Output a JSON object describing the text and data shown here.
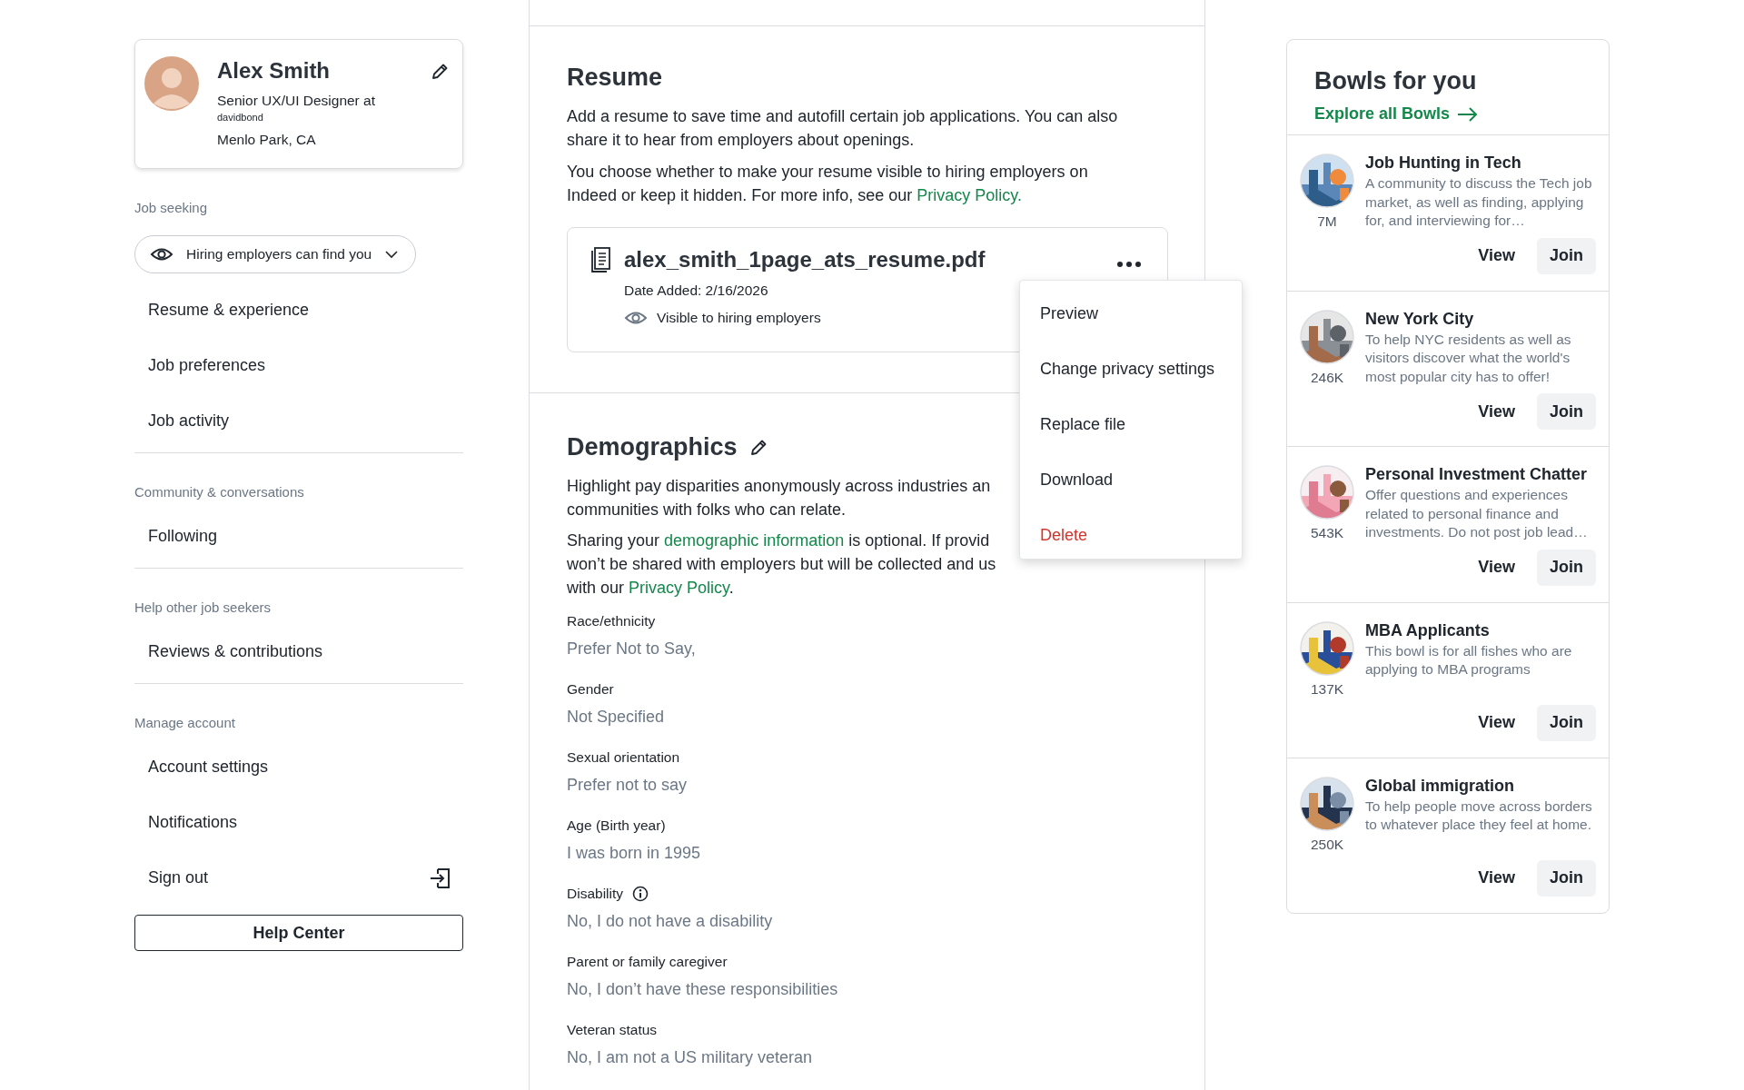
{
  "sidebar": {
    "profile": {
      "name": "Alex Smith",
      "title": "Senior UX/UI Designer at",
      "company": "davidbond",
      "location": "Menlo Park, CA"
    },
    "sections": [
      {
        "heading": "Job seeking",
        "items": [
          {
            "kind": "dropdown",
            "label": "Hiring employers can find you"
          },
          {
            "kind": "link",
            "label": "Resume & experience"
          },
          {
            "kind": "link",
            "label": "Job preferences"
          },
          {
            "kind": "link",
            "label": "Job activity"
          }
        ]
      },
      {
        "heading": "Community & conversations",
        "items": [
          {
            "kind": "link",
            "label": "Following"
          }
        ]
      },
      {
        "heading": "Help other job seekers",
        "items": [
          {
            "kind": "link",
            "label": "Reviews & contributions"
          }
        ]
      },
      {
        "heading": "Manage account",
        "items": [
          {
            "kind": "link",
            "label": "Account settings"
          },
          {
            "kind": "link",
            "label": "Notifications"
          },
          {
            "kind": "signout",
            "label": "Sign out"
          }
        ]
      }
    ],
    "help_button": "Help Center"
  },
  "resume": {
    "title": "Resume",
    "paragraphs": [
      [
        [
          {
            "kind": "text",
            "text": "Add a resume to save time and autofill certain job applications. You can also share it to hear from employers about openings."
          }
        ]
      ],
      [
        [
          {
            "kind": "text",
            "text": "You choose whether to make your resume visible to hiring employers on Indeed or keep it hidden. For more info, see our "
          },
          {
            "kind": "link",
            "text": "Privacy Policy."
          }
        ]
      ]
    ],
    "file": {
      "name": "alex_smith_1page_ats_resume.pdf",
      "date": "Date Added: 2/16/2026",
      "visibility": "Visible to hiring employers"
    },
    "menu": [
      {
        "kind": "normal",
        "label": "Preview"
      },
      {
        "kind": "normal",
        "label": "Change privacy settings"
      },
      {
        "kind": "normal",
        "label": "Replace file"
      },
      {
        "kind": "normal",
        "label": "Download"
      },
      {
        "kind": "danger",
        "label": "Delete"
      }
    ]
  },
  "demographics": {
    "title": "Demographics",
    "paragraphs": [
      [
        [
          {
            "kind": "text",
            "text": "Highlight pay disparities anonymously across industries an"
          }
        ],
        [
          {
            "kind": "text",
            "text": "communities with folks who can relate."
          }
        ]
      ],
      [
        [
          {
            "kind": "text",
            "text": "Sharing your "
          },
          {
            "kind": "link",
            "text": "demographic information"
          },
          {
            "kind": "text",
            "text": " is optional. If provid"
          }
        ],
        [
          {
            "kind": "text",
            "text": "won’t be shared with employers but will be collected and us"
          }
        ],
        [
          {
            "kind": "text",
            "text": "with our "
          },
          {
            "kind": "link",
            "text": "Privacy Policy"
          },
          {
            "kind": "text",
            "text": "."
          }
        ]
      ]
    ],
    "fields": [
      {
        "label": "Race/ethnicity",
        "value": "Prefer Not to Say,",
        "info": false
      },
      {
        "label": "Gender",
        "value": "Not Specified",
        "info": false
      },
      {
        "label": "Sexual orientation",
        "value": "Prefer not to say",
        "info": false
      },
      {
        "label": "Age (Birth year)",
        "value": "I was born in 1995",
        "info": false
      },
      {
        "label": "Disability",
        "value": "No, I do not have a disability",
        "info": true
      },
      {
        "label": "Parent or family caregiver",
        "value": "No, I don’t have these responsibilities",
        "info": false
      },
      {
        "label": "Veteran status",
        "value": "No, I am not a US military veteran",
        "info": false
      }
    ]
  },
  "bowls": {
    "title": "Bowls for you",
    "explore": "Explore all Bowls",
    "items": [
      {
        "name": "Job Hunting in Tech",
        "description": "A community to discuss the Tech job market, as well as finding, applying for, and interviewing for…",
        "members": "7M",
        "view": "View",
        "join": "Join"
      },
      {
        "name": "New York City",
        "description": "To help NYC residents as well as visitors discover what the world's most popular city has to offer!",
        "members": "246K",
        "view": "View",
        "join": "Join"
      },
      {
        "name": "Personal Investment Chatter",
        "description": "Offer questions and experiences related to personal finance and investments. Do not post job lead…",
        "members": "543K",
        "view": "View",
        "join": "Join"
      },
      {
        "name": "MBA Applicants",
        "description": "This bowl is for all fishes who are applying to MBA programs",
        "members": "137K",
        "view": "View",
        "join": "Join"
      },
      {
        "name": "Global immigration",
        "description": "To help people move across borders to whatever place they feel at home.",
        "members": "250K",
        "view": "View",
        "join": "Join"
      }
    ]
  }
}
